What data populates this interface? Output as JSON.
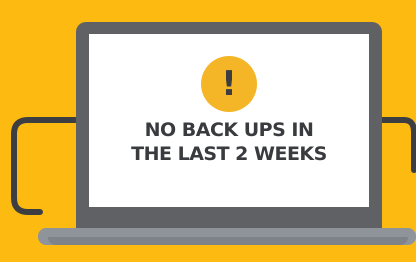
{
  "scene": {
    "background_color": "#fdbb12",
    "device": {
      "lid_color": "#5f6165",
      "screen_color": "#ffffff",
      "base_color": "#8f939a"
    },
    "alert": {
      "icon": "exclamation-icon",
      "symbol": "!",
      "icon_color": "#f4b526",
      "lines": [
        "NO BACK UPS IN",
        "THE LAST 2 WEEKS"
      ]
    }
  }
}
